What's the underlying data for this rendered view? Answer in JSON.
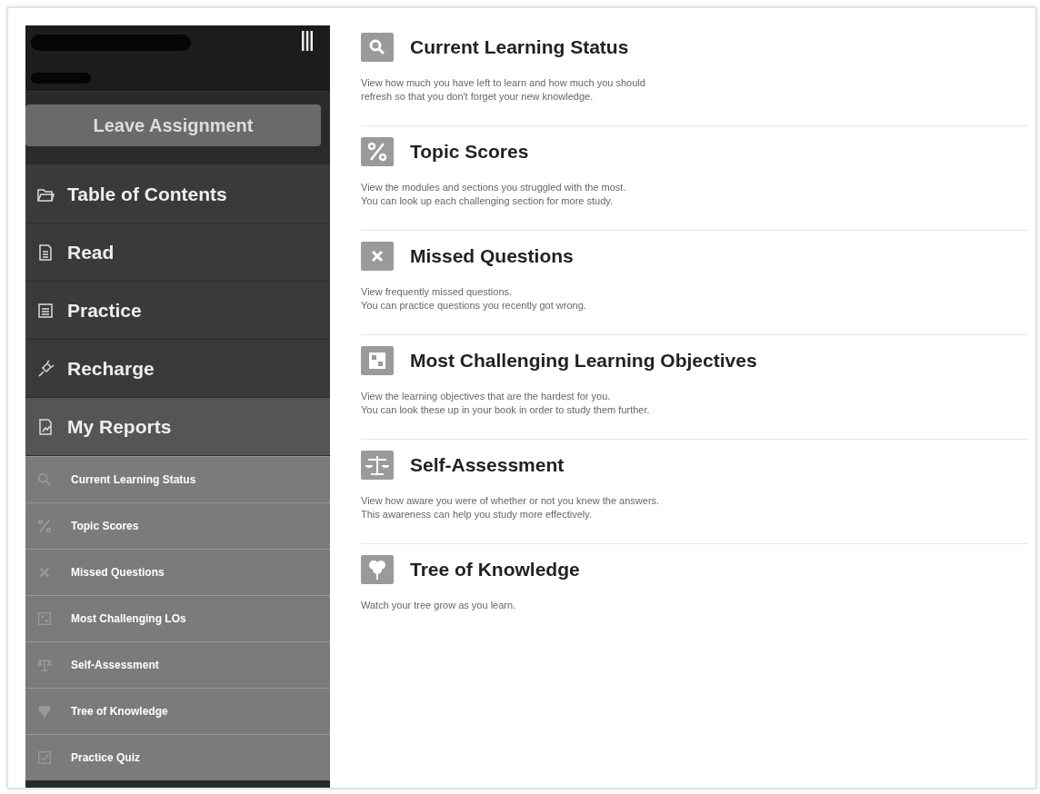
{
  "sidebar": {
    "leave_button": "Leave Assignment",
    "items": [
      {
        "label": "Table of Contents"
      },
      {
        "label": "Read"
      },
      {
        "label": "Practice"
      },
      {
        "label": "Recharge"
      },
      {
        "label": "My Reports",
        "expanded": true,
        "children": [
          {
            "label": "Current Learning Status"
          },
          {
            "label": "Topic Scores"
          },
          {
            "label": "Missed Questions"
          },
          {
            "label": "Most Challenging LOs"
          },
          {
            "label": "Self-Assessment"
          },
          {
            "label": "Tree of Knowledge"
          },
          {
            "label": "Practice Quiz"
          }
        ]
      }
    ]
  },
  "reports": [
    {
      "title": "Current Learning Status",
      "description": [
        "View how much you have left to learn and how much you should",
        "refresh so that you don't forget your new knowledge."
      ]
    },
    {
      "title": "Topic Scores",
      "description": [
        "View the modules and sections you struggled with the most.",
        "You can look up each challenging section for more study."
      ]
    },
    {
      "title": "Missed Questions",
      "description": [
        "View frequently missed questions.",
        "You can practice questions you recently got wrong."
      ]
    },
    {
      "title": "Most Challenging Learning Objectives",
      "description": [
        "View the learning objectives that are the hardest for you.",
        "You can look these up in your book in order to study them further."
      ]
    },
    {
      "title": "Self-Assessment",
      "description": [
        "View how aware you were of whether or not you knew the answers.",
        "This awareness can help you study more effectively."
      ]
    },
    {
      "title": "Tree of Knowledge",
      "description": [
        "Watch your tree grow as you learn."
      ]
    }
  ]
}
